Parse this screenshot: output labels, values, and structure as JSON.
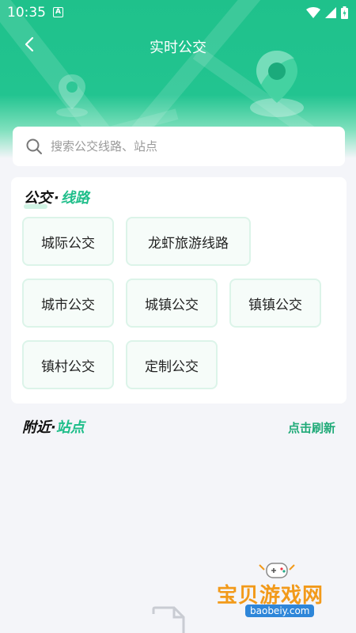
{
  "status_bar": {
    "time": "10:35",
    "notification_icon_letter": "A",
    "icons": [
      "wifi-icon",
      "signal-icon",
      "battery-icon"
    ]
  },
  "header": {
    "title": "实时公交",
    "back_icon": "back-arrow-icon"
  },
  "search": {
    "placeholder": "搜索公交线路、站点"
  },
  "routes_section": {
    "title_part1": "公交",
    "title_dot": "·",
    "title_part2": "线路",
    "items": [
      {
        "label": "城际公交"
      },
      {
        "label": "龙虾旅游线路"
      },
      {
        "label": "城市公交"
      },
      {
        "label": "城镇公交"
      },
      {
        "label": "镇镇公交"
      },
      {
        "label": "镇村公交"
      },
      {
        "label": "定制公交"
      }
    ]
  },
  "nearby_section": {
    "title_part1": "附近",
    "title_dot": "·",
    "title_part2": "站点",
    "refresh_label": "点击刷新"
  },
  "watermark": {
    "text": "宝贝游戏网",
    "url": "baobeiy.com"
  },
  "colors": {
    "primary": "#1fc18b",
    "accent_text": "#1fbe8a",
    "background": "#f4f5f9",
    "watermark": "#f29a1a"
  }
}
